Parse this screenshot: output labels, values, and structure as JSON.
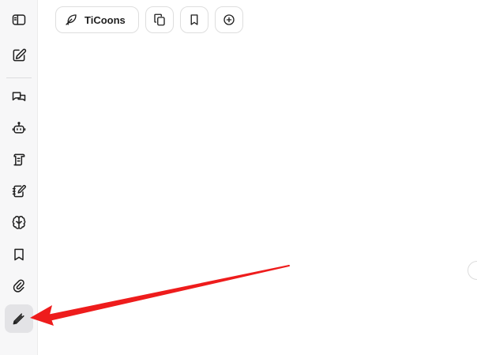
{
  "toolbar": {
    "model_label": "TiCoons"
  },
  "icons": {
    "sidebar": [
      "sidebar-toggle-icon",
      "new-chat-icon",
      "chats-icon",
      "assistant-bot-icon",
      "prompts-scroll-icon",
      "notebook-edit-icon",
      "brain-icon",
      "bookmark-icon",
      "paperclip-icon",
      "pen-tool-icon"
    ],
    "toolbar": [
      "feather-icon",
      "copy-icon",
      "bookmark-icon",
      "add-circle-icon"
    ]
  },
  "colors": {
    "annotation_arrow": "#ee1c1c",
    "sidebar_bg": "#f7f7f8",
    "active_bg": "#e3e3e6"
  }
}
